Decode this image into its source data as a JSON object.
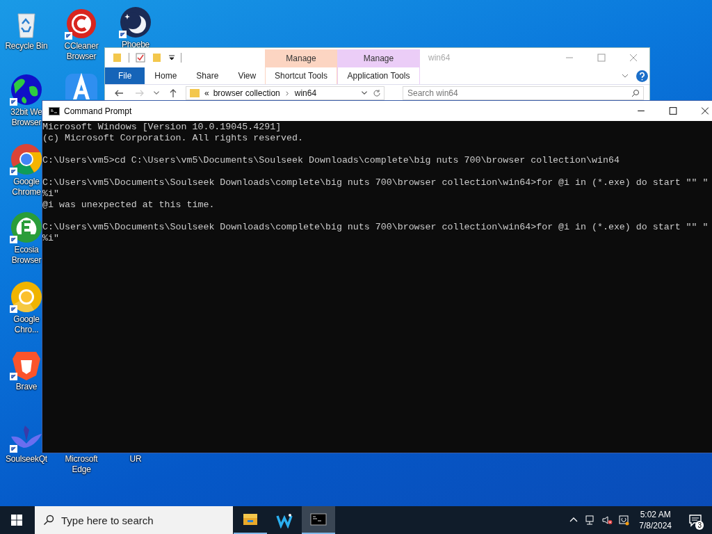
{
  "desktop": {
    "icons": [
      {
        "kind": "recycle",
        "label": [
          "Recycle Bin"
        ]
      },
      {
        "kind": "ccleaner",
        "label": [
          "CCleaner",
          "Browser"
        ],
        "shortcut": true
      },
      {
        "kind": "moon",
        "label": [
          "Phoebe"
        ],
        "shortcut": true
      },
      {
        "kind": "appstore"
      },
      {
        "kind": "globe",
        "label": [
          "32bit We",
          "Browser"
        ],
        "shortcut": true
      },
      {
        "kind": "chrome",
        "label": [
          "Google",
          "Chrome"
        ],
        "shortcut": true
      },
      {
        "kind": "ecosia",
        "label": [
          "Ecosia",
          "Browser"
        ],
        "shortcut": true
      },
      {
        "kind": "chromium",
        "label": [
          "Google",
          "Chro..."
        ],
        "shortcut": true
      },
      {
        "kind": "brave",
        "label": [
          "Brave"
        ],
        "shortcut": true
      },
      {
        "kind": "soulseek",
        "label": [
          "SoulseekQt"
        ],
        "shortcut": true
      },
      {
        "label": [
          "Microsoft",
          "Edge"
        ]
      },
      {
        "label": [
          "UR"
        ]
      }
    ]
  },
  "explorer": {
    "title": "win64",
    "tabs": [
      {
        "label": "File",
        "kind": "file"
      },
      {
        "label": "Home",
        "kind": "plain"
      },
      {
        "label": "Share",
        "kind": "plain"
      },
      {
        "label": "View",
        "kind": "plain"
      },
      {
        "label": "Shortcut Tools",
        "kind": "contextual",
        "header": "Manage",
        "color": "#fcd5c2"
      },
      {
        "label": "Application Tools",
        "kind": "contextual",
        "header": "Manage",
        "color": "#ebcdf7"
      }
    ],
    "address": {
      "overflow": "«",
      "path": [
        "browser collection",
        "win64"
      ]
    },
    "search": {
      "placeholder": "Search win64"
    }
  },
  "cmd": {
    "title": "Command Prompt",
    "blocks": [
      [
        "Microsoft Windows [Version 10.0.19045.4291]",
        "(c) Microsoft Corporation. All rights reserved."
      ],
      [
        "C:\\Users\\vm5>cd C:\\Users\\vm5\\Documents\\Soulseek Downloads\\complete\\big nuts 700\\browser collection\\win64"
      ],
      [
        "C:\\Users\\vm5\\Documents\\Soulseek Downloads\\complete\\big nuts 700\\browser collection\\win64>for @i in (*.exe) do start \"\" \"",
        "%i\"",
        "@i was unexpected at this time."
      ],
      [
        "C:\\Users\\vm5\\Documents\\Soulseek Downloads\\complete\\big nuts 700\\browser collection\\win64>for @i in (*.exe) do start \"\" \"",
        "%i\""
      ]
    ]
  },
  "taskbar": {
    "search": {
      "placeholder": "Type here to search"
    },
    "apps": [
      {
        "kind": "explorer",
        "running": true,
        "active": false
      },
      {
        "kind": "wave",
        "running": false,
        "active": false
      },
      {
        "kind": "terminal",
        "running": true,
        "active": true
      }
    ],
    "clock": {
      "time": "5:02 AM",
      "date": "7/8/2024"
    },
    "notifications": {
      "count": "3"
    }
  }
}
